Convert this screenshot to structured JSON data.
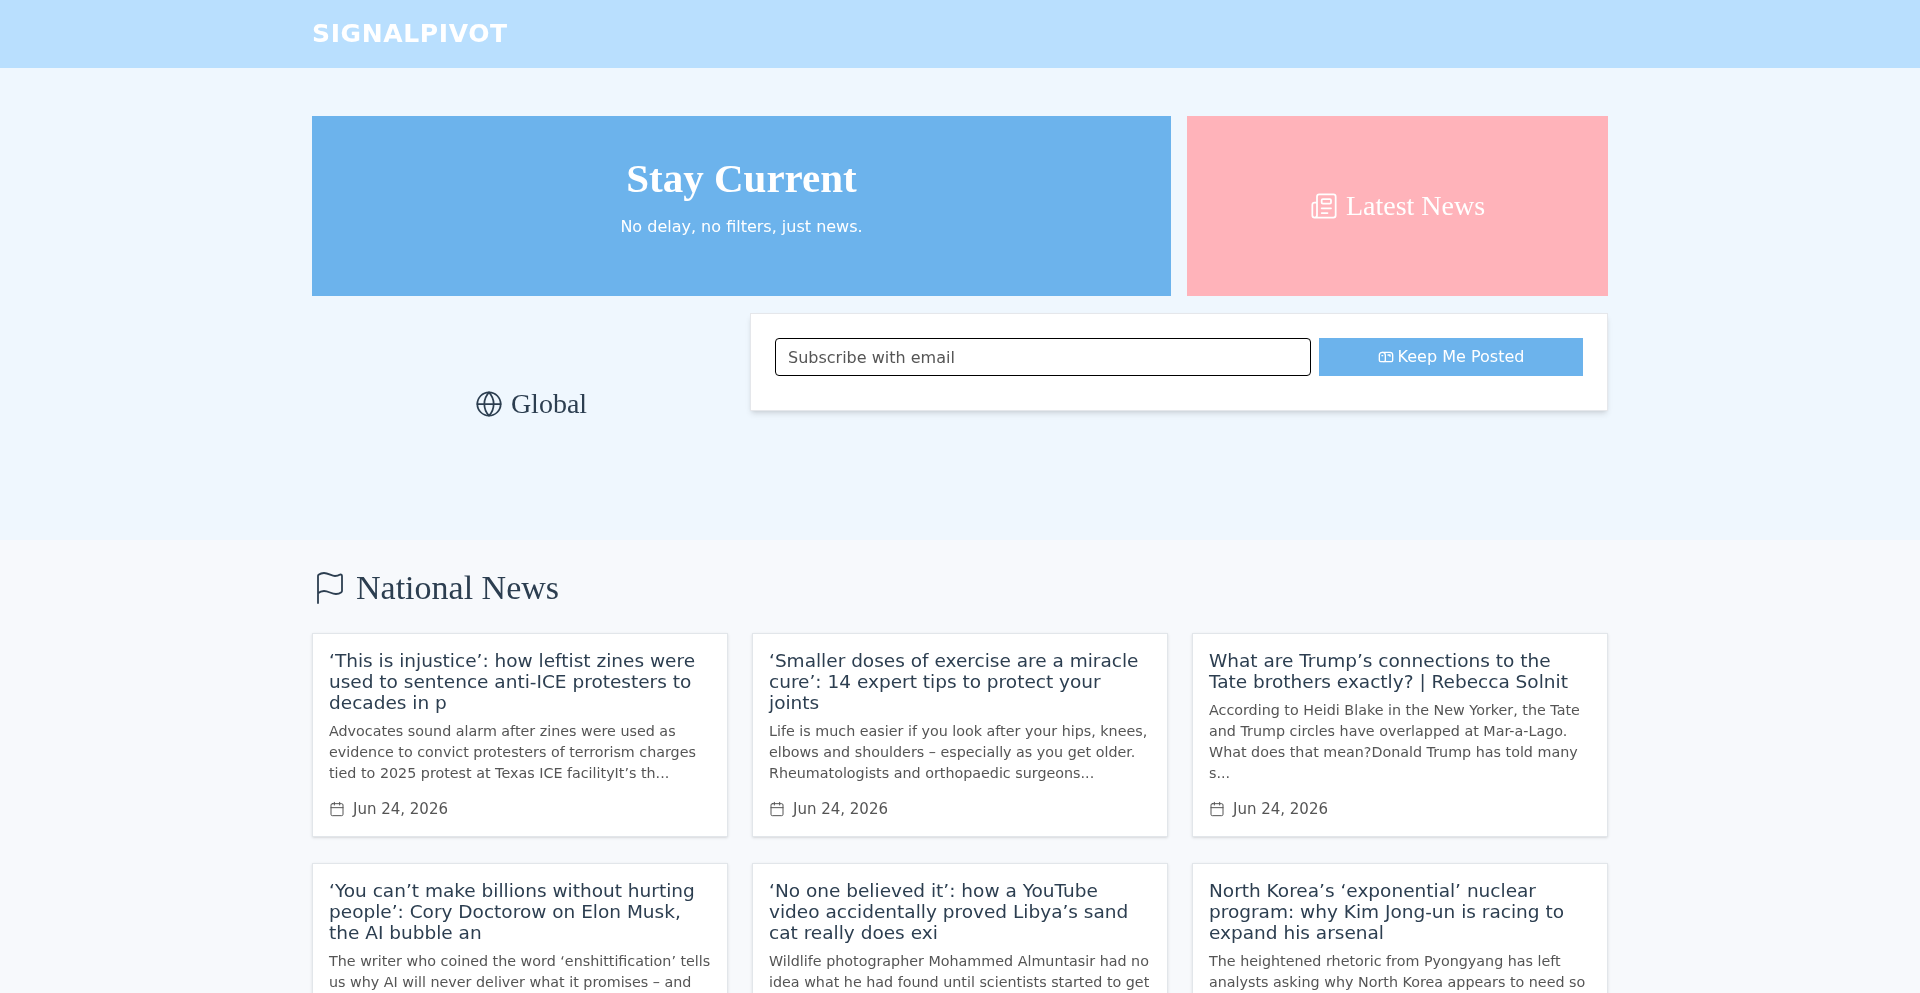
{
  "brand": "SIGNALPIVOT",
  "hero": {
    "title": "Stay Current",
    "subtitle": "No delay, no filters, just news."
  },
  "latest": {
    "label": "Latest News"
  },
  "region": {
    "label": "Global"
  },
  "subscribe": {
    "placeholder": "Subscribe with email",
    "button": "Keep Me Posted"
  },
  "section": {
    "title": "National News"
  },
  "articles": [
    {
      "title": "‘This is injustice’: how leftist zines were used to sentence anti-ICE protesters to decades in p",
      "excerpt": "Advocates sound alarm after zines were used as evidence to convict protesters of terrorism charges tied to 2025 protest at Texas ICE facilityIt’s th...",
      "date": "Jun 24, 2026"
    },
    {
      "title": "‘Smaller doses of exercise are a miracle cure’: 14 expert tips to protect your joints",
      "excerpt": "Life is much easier if you look after your hips, knees, elbows and shoulders – especially as you get older. Rheumatologists and orthopaedic surgeons...",
      "date": "Jun 24, 2026"
    },
    {
      "title": "What are Trump’s connections to the Tate brothers exactly? | Rebecca Solnit",
      "excerpt": "According to Heidi Blake in the New Yorker, the Tate and Trump circles have overlapped at Mar-a-Lago. What does that mean?Donald Trump has told many s...",
      "date": "Jun 24, 2026"
    },
    {
      "title": "‘You can’t make billions without hurting people’: Cory Doctorow on Elon Musk, the AI bubble an",
      "excerpt": "The writer who coined the word ‘enshittification’ tells us why AI will never deliver what it promises – and"
    },
    {
      "title": "‘No one believed it’: how a YouTube video accidentally proved Libya’s sand cat really does exi",
      "excerpt": "Wildlife photographer Mohammed Almuntasir had no idea what he had found until scientists started to get"
    },
    {
      "title": "North Korea’s ‘exponential’ nuclear program: why Kim Jong-un is racing to expand his arsenal",
      "excerpt": "The heightened rhetoric from Pyongyang has left analysts asking why North Korea appears to need so"
    }
  ]
}
